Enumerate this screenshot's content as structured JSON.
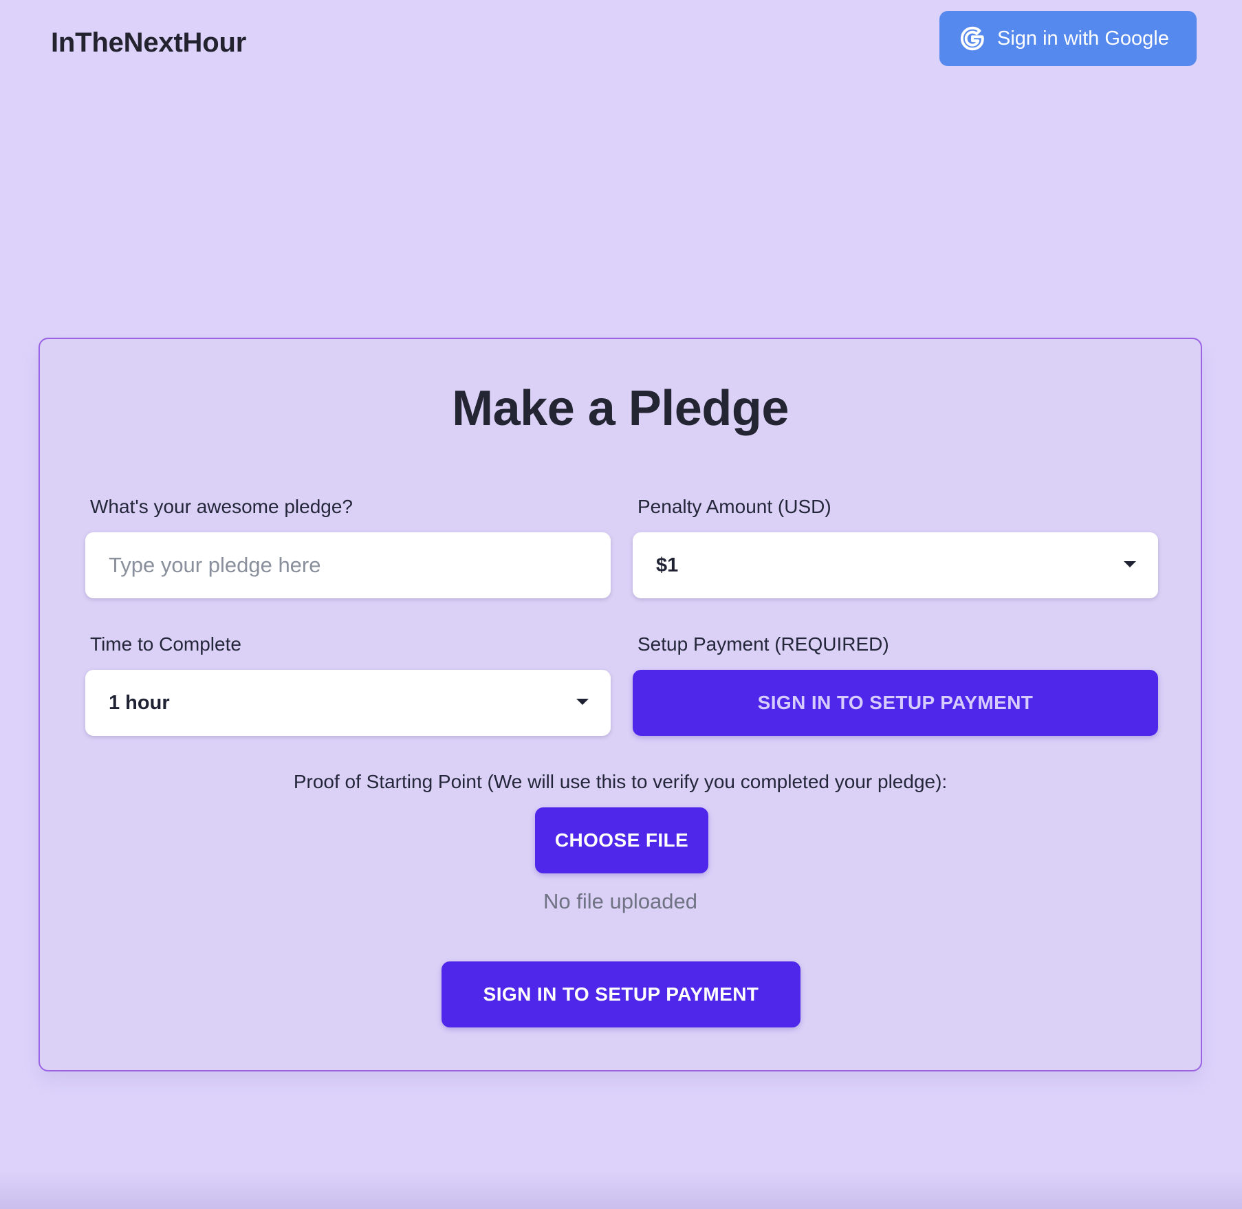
{
  "header": {
    "brand": "InTheNextHour",
    "google_button_label": "Sign in with Google",
    "google_icon": "google-g-icon"
  },
  "card": {
    "title": "Make a Pledge",
    "pledge": {
      "label": "What's your awesome pledge?",
      "value": "",
      "placeholder": "Type your pledge here"
    },
    "penalty": {
      "label": "Penalty Amount (USD)",
      "selected": "$1",
      "icon": "chevron-down-icon"
    },
    "time": {
      "label": "Time to Complete",
      "selected": "1 hour",
      "icon": "chevron-down-icon"
    },
    "payment": {
      "label": "Setup Payment (REQUIRED)",
      "button_label": "SIGN IN TO SETUP PAYMENT"
    },
    "proof": {
      "label": "Proof of Starting Point (We will use this to verify you completed your pledge):",
      "choose_file_label": "CHOOSE FILE",
      "status": "No file uploaded"
    },
    "submit_label": "SIGN IN TO SETUP PAYMENT"
  },
  "colors": {
    "background": "#ddd3fa",
    "card_border": "#9b63e3",
    "primary": "#4f27ea",
    "google_button": "#5689ee"
  }
}
